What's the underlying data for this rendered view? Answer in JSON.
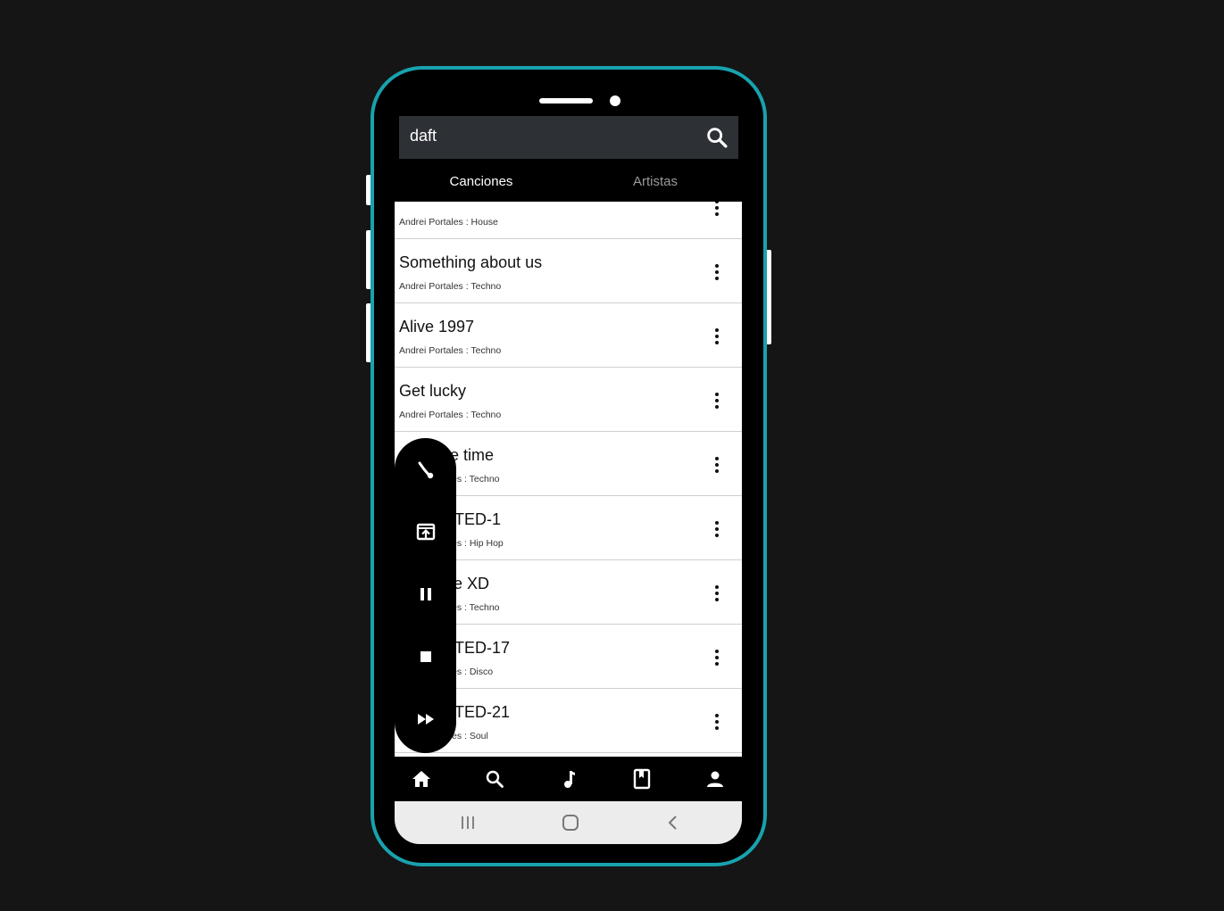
{
  "search": {
    "query": "daft"
  },
  "tabs": [
    {
      "label": "Canciones",
      "active": true
    },
    {
      "label": "Artistas",
      "active": false
    }
  ],
  "songs": [
    {
      "title": "",
      "subtitle": "Andrei Portales : House"
    },
    {
      "title": "Something about us",
      "subtitle": "Andrei Portales : Techno"
    },
    {
      "title": "Alive 1997",
      "subtitle": "Andrei Portales : Techno"
    },
    {
      "title": "Get lucky",
      "subtitle": "Andrei Portales : Techno"
    },
    {
      "title": "re time",
      "subtitle": "es : Techno"
    },
    {
      "title": "TED-1",
      "subtitle": "es : Hip Hop"
    },
    {
      "title": "e XD",
      "subtitle": "es : Techno"
    },
    {
      "title": "TED-17",
      "subtitle": "es : Disco"
    },
    {
      "title": "TED-21",
      "subtitle": "es : Soul"
    }
  ],
  "player_controls": [
    "shuffle-icon",
    "open-player-icon",
    "pause-icon",
    "stop-icon",
    "fast-forward-icon"
  ],
  "bottom_nav": [
    "home-icon",
    "search-icon",
    "music-note-icon",
    "library-icon",
    "profile-icon"
  ],
  "system_nav": [
    "recents-icon",
    "home-circle-icon",
    "back-icon"
  ],
  "colors": {
    "accent": "#18a2ae",
    "search_bar": "#2d3136",
    "background": "#151515"
  }
}
